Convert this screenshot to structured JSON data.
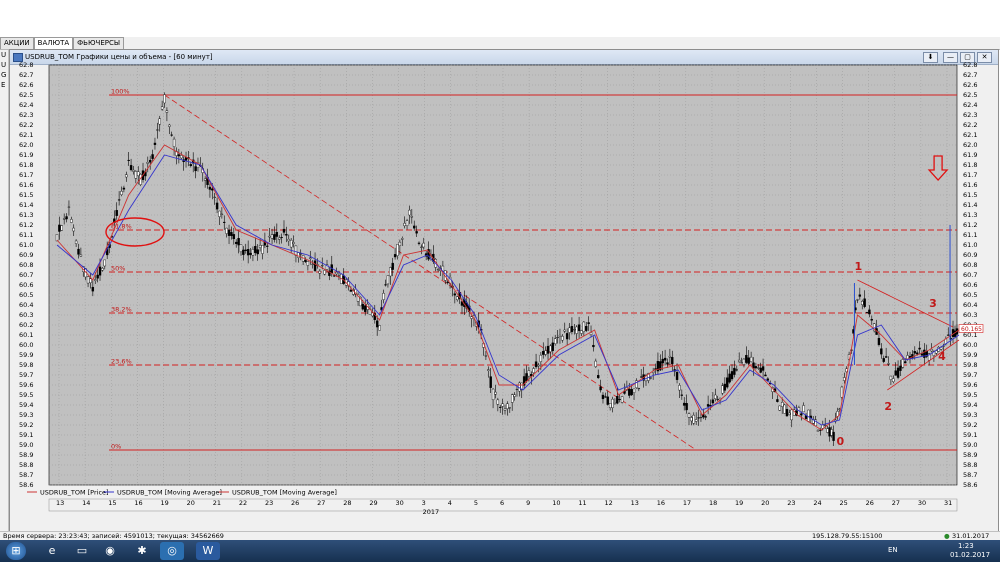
{
  "tabs": [
    {
      "label": "АКЦИИ"
    },
    {
      "label": "ВАЛЮТА"
    },
    {
      "label": "ФЬЮЧЕРСЫ"
    }
  ],
  "left_strip": [
    "U",
    "U",
    "G",
    "E"
  ],
  "window": {
    "title": "USDRUB_TOM Графики цены и объема - [60 минут]",
    "buttons": [
      "⬇",
      "—",
      "▢",
      "✕"
    ]
  },
  "chart_data": {
    "type": "line",
    "series": [
      {
        "name": "USDRUB_TOM [Price]",
        "color": "#cc3333"
      },
      {
        "name": "USDRUB_TOM [Moving Average]",
        "color": "#3333cc"
      },
      {
        "name": "USDRUB_TOM [Moving Average]",
        "color": "#cc3333"
      }
    ],
    "price_path": [
      [
        0,
        61.1
      ],
      [
        2,
        61.35
      ],
      [
        4,
        60.85
      ],
      [
        6,
        60.55
      ],
      [
        8,
        60.85
      ],
      [
        10,
        61.3
      ],
      [
        12,
        61.8
      ],
      [
        14,
        61.65
      ],
      [
        16,
        61.9
      ],
      [
        18,
        62.45
      ],
      [
        20,
        61.9
      ],
      [
        22,
        61.85
      ],
      [
        24,
        61.75
      ],
      [
        26,
        61.55
      ],
      [
        28,
        61.2
      ],
      [
        30,
        61.05
      ],
      [
        32,
        60.9
      ],
      [
        34,
        60.95
      ],
      [
        36,
        61.05
      ],
      [
        38,
        61.1
      ],
      [
        40,
        60.95
      ],
      [
        42,
        60.85
      ],
      [
        44,
        60.75
      ],
      [
        46,
        60.75
      ],
      [
        48,
        60.65
      ],
      [
        50,
        60.5
      ],
      [
        52,
        60.35
      ],
      [
        54,
        60.2
      ],
      [
        55,
        60.6
      ],
      [
        57,
        60.95
      ],
      [
        59,
        61.3
      ],
      [
        61,
        61.0
      ],
      [
        63,
        60.85
      ],
      [
        65,
        60.7
      ],
      [
        67,
        60.5
      ],
      [
        69,
        60.35
      ],
      [
        71,
        60.15
      ],
      [
        73,
        59.5
      ],
      [
        75,
        59.35
      ],
      [
        77,
        59.55
      ],
      [
        79,
        59.7
      ],
      [
        81,
        59.85
      ],
      [
        83,
        60.0
      ],
      [
        85,
        60.1
      ],
      [
        87,
        60.15
      ],
      [
        89,
        60.2
      ],
      [
        91,
        59.55
      ],
      [
        93,
        59.4
      ],
      [
        95,
        59.5
      ],
      [
        97,
        59.6
      ],
      [
        99,
        59.7
      ],
      [
        101,
        59.8
      ],
      [
        103,
        59.85
      ],
      [
        105,
        59.4
      ],
      [
        107,
        59.2
      ],
      [
        109,
        59.35
      ],
      [
        111,
        59.5
      ],
      [
        113,
        59.7
      ],
      [
        115,
        59.85
      ],
      [
        117,
        59.8
      ],
      [
        119,
        59.7
      ],
      [
        121,
        59.4
      ],
      [
        123,
        59.3
      ],
      [
        125,
        59.35
      ],
      [
        127,
        59.2
      ],
      [
        129,
        59.15
      ],
      [
        130,
        59.1
      ],
      [
        131,
        59.4
      ],
      [
        133,
        60.0
      ],
      [
        134,
        60.5
      ],
      [
        136,
        60.35
      ],
      [
        138,
        59.95
      ],
      [
        140,
        59.65
      ],
      [
        142,
        59.85
      ],
      [
        144,
        59.95
      ],
      [
        146,
        59.9
      ],
      [
        148,
        60.0
      ],
      [
        150,
        60.1
      ],
      [
        151,
        60.2
      ]
    ],
    "ma_blue_path": [
      [
        0,
        61.0
      ],
      [
        6,
        60.7
      ],
      [
        12,
        61.35
      ],
      [
        18,
        61.9
      ],
      [
        24,
        61.8
      ],
      [
        30,
        61.2
      ],
      [
        36,
        61.0
      ],
      [
        42,
        60.9
      ],
      [
        48,
        60.7
      ],
      [
        54,
        60.3
      ],
      [
        58,
        60.8
      ],
      [
        62,
        60.9
      ],
      [
        66,
        60.65
      ],
      [
        70,
        60.3
      ],
      [
        74,
        59.7
      ],
      [
        78,
        59.55
      ],
      [
        84,
        59.9
      ],
      [
        90,
        60.1
      ],
      [
        94,
        59.55
      ],
      [
        100,
        59.7
      ],
      [
        104,
        59.75
      ],
      [
        108,
        59.35
      ],
      [
        112,
        59.45
      ],
      [
        116,
        59.75
      ],
      [
        120,
        59.6
      ],
      [
        124,
        59.35
      ],
      [
        128,
        59.2
      ],
      [
        131,
        59.25
      ],
      [
        134,
        60.1
      ],
      [
        138,
        60.2
      ],
      [
        142,
        59.85
      ],
      [
        146,
        59.9
      ],
      [
        151,
        60.1
      ]
    ],
    "ma_red_path": [
      [
        0,
        61.05
      ],
      [
        6,
        60.65
      ],
      [
        12,
        61.5
      ],
      [
        18,
        62.0
      ],
      [
        24,
        61.8
      ],
      [
        30,
        61.15
      ],
      [
        36,
        61.0
      ],
      [
        42,
        60.85
      ],
      [
        48,
        60.65
      ],
      [
        54,
        60.25
      ],
      [
        58,
        60.9
      ],
      [
        62,
        60.95
      ],
      [
        66,
        60.6
      ],
      [
        70,
        60.25
      ],
      [
        74,
        59.6
      ],
      [
        78,
        59.6
      ],
      [
        84,
        59.95
      ],
      [
        90,
        60.15
      ],
      [
        94,
        59.5
      ],
      [
        100,
        59.75
      ],
      [
        104,
        59.8
      ],
      [
        108,
        59.3
      ],
      [
        112,
        59.5
      ],
      [
        116,
        59.8
      ],
      [
        120,
        59.55
      ],
      [
        124,
        59.3
      ],
      [
        128,
        59.15
      ],
      [
        131,
        59.3
      ],
      [
        134,
        60.3
      ],
      [
        138,
        60.1
      ],
      [
        142,
        59.85
      ],
      [
        146,
        59.95
      ],
      [
        151,
        60.15
      ]
    ],
    "fib_levels": [
      {
        "label": "100%",
        "value": 62.5,
        "style": "solid"
      },
      {
        "label": "61.8%",
        "value": 61.15,
        "style": "dashed"
      },
      {
        "label": "50%",
        "value": 60.73,
        "style": "dashed"
      },
      {
        "label": "38.2%",
        "value": 60.32,
        "style": "dashed"
      },
      {
        "label": "23.6%",
        "value": 59.8,
        "style": "dashed"
      },
      {
        "label": "0%",
        "value": 58.95,
        "style": "solid"
      }
    ],
    "y_ticks": [
      "62.8",
      "62.7",
      "62.6",
      "62.5",
      "62.4",
      "62.3",
      "62.2",
      "62.1",
      "62.0",
      "61.9",
      "61.8",
      "61.7",
      "61.6",
      "61.5",
      "61.4",
      "61.3",
      "61.2",
      "61.1",
      "61.0",
      "60.9",
      "60.8",
      "60.7",
      "60.6",
      "60.5",
      "60.4",
      "60.3",
      "60.2",
      "60.1",
      "60.0",
      "59.9",
      "59.8",
      "59.7",
      "59.6",
      "59.5",
      "59.4",
      "59.3",
      "59.2",
      "59.1",
      "59.0",
      "58.9",
      "58.8",
      "58.7",
      "58.6"
    ],
    "ylim": [
      58.6,
      62.8
    ],
    "x_ticks": [
      "13",
      "14",
      "15",
      "16",
      "19",
      "20",
      "21",
      "22",
      "23",
      "26",
      "27",
      "28",
      "29",
      "30",
      "3",
      "4",
      "5",
      "6",
      "9",
      "10",
      "11",
      "12",
      "13",
      "16",
      "17",
      "18",
      "19",
      "20",
      "23",
      "24",
      "25",
      "26",
      "27",
      "30",
      "31"
    ],
    "x_year_label": "2017",
    "current_price": "60.165",
    "annotations": [
      {
        "text": "1",
        "x": 134,
        "y": 60.75
      },
      {
        "text": "2",
        "x": 139,
        "y": 59.35
      },
      {
        "text": "3",
        "x": 146.5,
        "y": 60.38
      },
      {
        "text": "4",
        "x": 148,
        "y": 59.85
      },
      {
        "text": "0",
        "x": 131,
        "y": 59.0
      }
    ]
  },
  "status": {
    "left": "Время сервера: 23:23:43; записей: 4591013; текущая: 34562669",
    "ip": "195.128.79.55:15100",
    "date": "31.01.2017"
  },
  "taskbar": {
    "lang": "EN",
    "time": "1:23",
    "date": "01.02.2017"
  }
}
